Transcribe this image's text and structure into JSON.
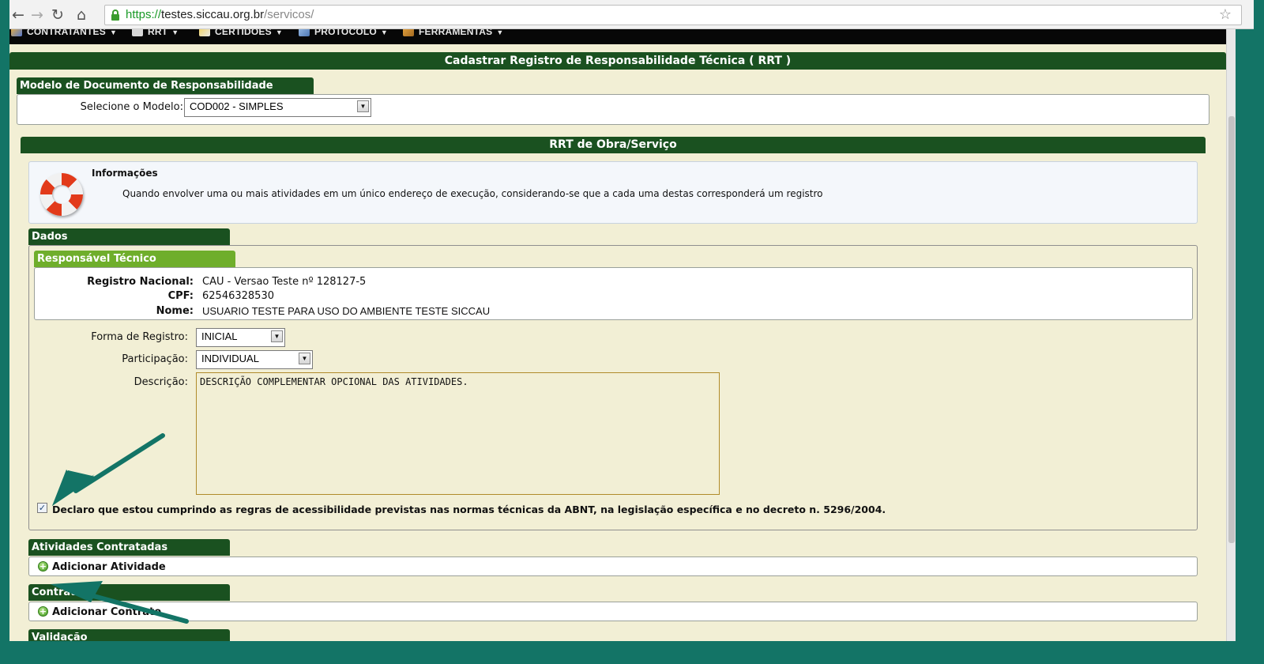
{
  "browser": {
    "url_scheme": "https://",
    "url_host": "testes.siccau.org.br",
    "url_path": "/servicos/"
  },
  "menu": {
    "items": [
      {
        "label": "CONTRATANTES",
        "icon": "users-icon"
      },
      {
        "label": "RRT",
        "icon": "document-icon"
      },
      {
        "label": "CERTIDÕES",
        "icon": "certificate-icon"
      },
      {
        "label": "PROTOCOLO",
        "icon": "protocol-icon"
      },
      {
        "label": "FERRAMENTAS",
        "icon": "wrench-icon"
      }
    ]
  },
  "page": {
    "title": "Cadastrar Registro de Responsabilidade Técnica ( RRT )",
    "modelo": {
      "tab_label": "Modelo de Documento de Responsabilidade Técnica",
      "select_label": "Selecione o Modelo:",
      "select_value": "COD002 - SIMPLES"
    },
    "obra": {
      "title": "RRT de Obra/Serviço",
      "info_title": "Informações",
      "info_text": "Quando envolver uma ou mais atividades em um único endereço de execução, considerando-se que a cada uma destas corresponderá um registro"
    },
    "dados": {
      "tab_label": "Dados",
      "responsavel": {
        "tab_label": "Responsável Técnico",
        "registro_label": "Registro Nacional:",
        "registro_value": "CAU - Versao Teste nº 128127-5",
        "cpf_label": "CPF:",
        "cpf_value": "62546328530",
        "nome_label": "Nome:",
        "nome_value": "USUARIO TESTE PARA USO DO AMBIENTE TESTE SICCAU"
      },
      "forma_label": "Forma de Registro:",
      "forma_value": "INICIAL",
      "participacao_label": "Participação:",
      "participacao_value": "INDIVIDUAL",
      "descricao_label": "Descrição:",
      "descricao_value": "DESCRIÇÃO COMPLEMENTAR OPCIONAL DAS ATIVIDADES.",
      "declaro_text": "Declaro que estou cumprindo as regras de acessibilidade previstas nas normas técnicas da ABNT, na legislação específica e no decreto n. 5296/2004.",
      "declaro_checked": true
    },
    "atividades": {
      "tab_label": "Atividades Contratadas",
      "add_label": "Adicionar Atividade"
    },
    "contrato": {
      "tab_label": "Contrato",
      "add_label": "Adicionar Contrato"
    },
    "validacao": {
      "tab_label": "Validação"
    }
  },
  "colors": {
    "accent_dark_green": "#1a5120",
    "accent_light_green": "#6fae2b",
    "page_background": "#f2efd5",
    "annotation_arrow": "#137466"
  }
}
